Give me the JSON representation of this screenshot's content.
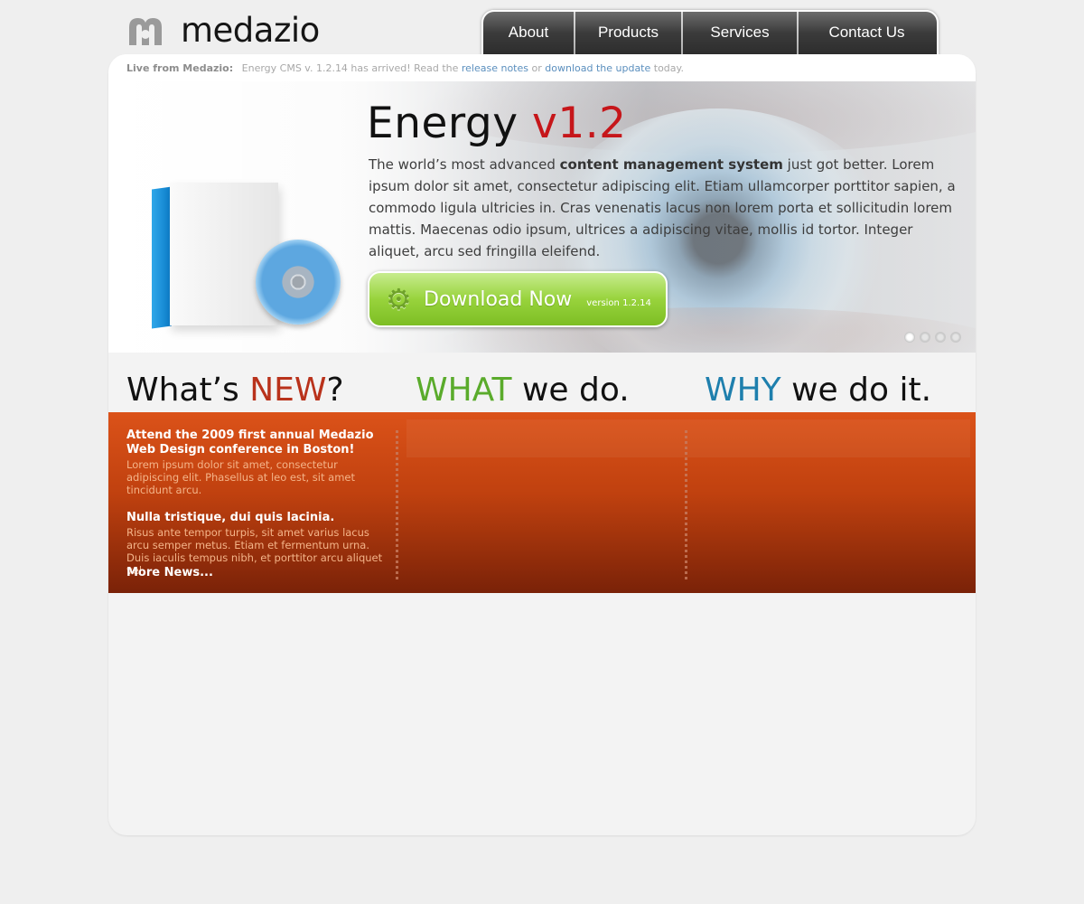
{
  "logo": {
    "text": "medazio"
  },
  "nav": {
    "items": [
      "About",
      "Products",
      "Services",
      "Contact Us"
    ]
  },
  "livebar": {
    "label": "Live from Medazio:",
    "message": "Energy CMS v. 1.2.14 has arrived!  Read the",
    "link1": "release notes",
    "or": "or",
    "link2": "download the update",
    "suffix": "today."
  },
  "hero": {
    "title_main": "Energy",
    "title_version": "v1.2",
    "text_before": "The world’s most advanced",
    "text_bold": "content management system",
    "text_after": "just got better. Lorem ipsum dolor sit amet, consectetur adipiscing elit. Etiam ullamcorper porttitor sapien, a commodo ligula ultricies in. Cras venenatis lacus non lorem porta et sollicitudin lorem mattis. Maecenas odio ipsum, ultrices a adipiscing vitae, mollis id tortor. Integer aliquet, arcu sed fringilla eleifend.",
    "button_label": "Download Now",
    "button_version": "version 1.2.14",
    "button_icon": "gear-icon",
    "slides": 4,
    "active_slide": 1
  },
  "columns": {
    "news_head_pre": "What’s",
    "news_head_accent": "NEW",
    "news_head_post": "?",
    "what_head_accent": "WHAT",
    "what_head_post": "we do.",
    "why_head_accent": "WHY",
    "why_head_post": "we do it."
  },
  "news": {
    "items": [
      {
        "title": "Attend the 2009 first annual Medazio Web Design conference in Boston!",
        "body": "Lorem ipsum dolor sit amet, consectetur adipiscing elit. Phasellus at leo est, sit amet tincidunt arcu."
      },
      {
        "title": "Nulla tristique, dui quis lacinia.",
        "body": "Risus ante tempor turpis, sit amet varius lacus arcu semper metus. Etiam et fermentum urna. Duis iaculis tempus nibh, et porttitor arcu aliquet vel."
      }
    ],
    "more": "More News..."
  },
  "colors": {
    "accent_red": "#c6161a",
    "news_red": "#b9321b",
    "green": "#5aab2b",
    "blue": "#1e7fad",
    "orange": "#db5219"
  }
}
